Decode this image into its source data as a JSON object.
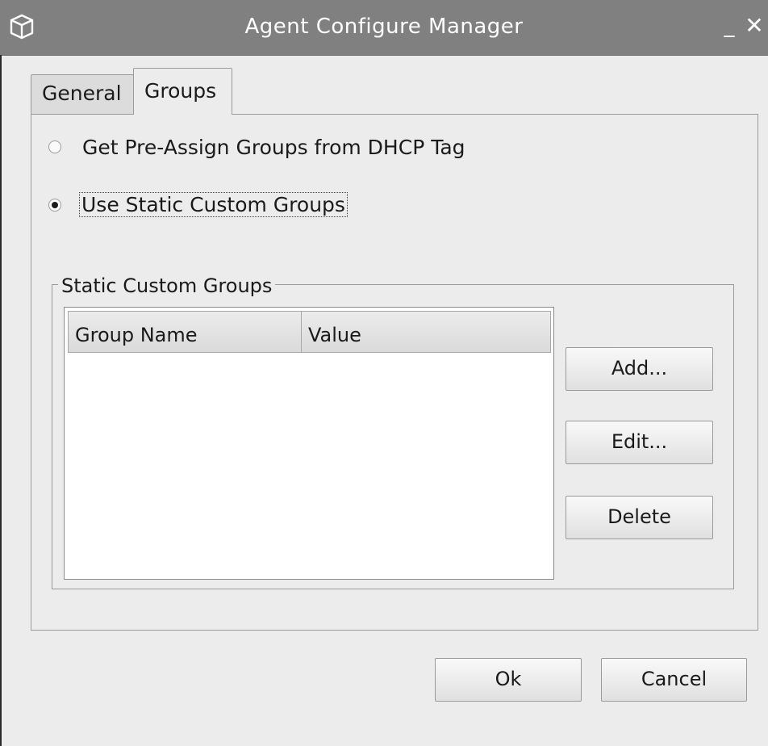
{
  "window": {
    "title": "Agent Configure Manager",
    "icon": "cube-icon",
    "minimize_symbol": "_",
    "close_symbol": "✕"
  },
  "tabs": [
    {
      "label": "General",
      "selected": false
    },
    {
      "label": "Groups",
      "selected": true
    }
  ],
  "groups_tab": {
    "radio_options": [
      {
        "label": "Get Pre-Assign Groups from DHCP Tag",
        "selected": false
      },
      {
        "label": "Use Static Custom Groups",
        "selected": true
      }
    ],
    "static_groups": {
      "legend": "Static Custom Groups",
      "columns": [
        "Group Name",
        "Value"
      ],
      "rows": [],
      "buttons": {
        "add": "Add...",
        "edit": "Edit...",
        "delete": "Delete"
      }
    }
  },
  "dialog_buttons": {
    "ok": "Ok",
    "cancel": "Cancel"
  },
  "colors": {
    "titlebar": "#808080",
    "background": "#ececec",
    "table_background": "#ffffff"
  }
}
